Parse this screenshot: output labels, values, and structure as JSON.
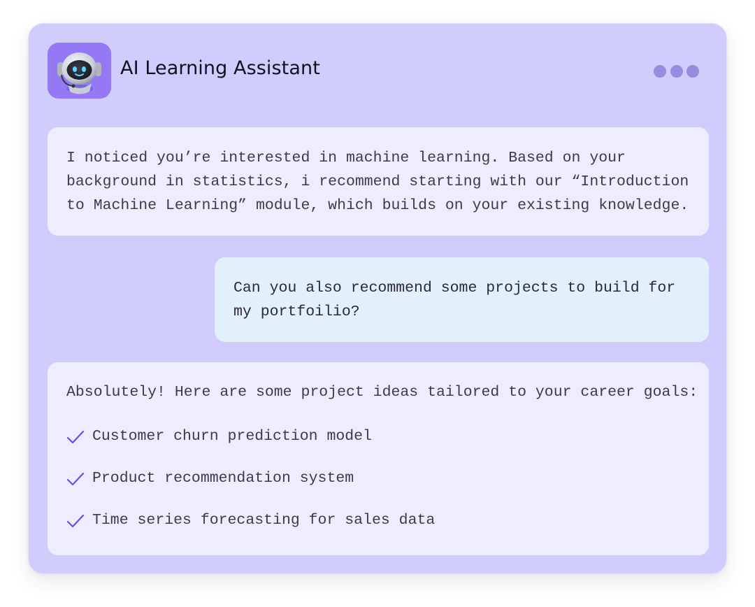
{
  "header": {
    "title": "AI Learning Assistant",
    "avatar_icon": "robot-icon",
    "menu_icon": "more-horizontal-icon"
  },
  "messages": [
    {
      "sender": "assistant",
      "text": "I noticed you’re interested in machine learning. Based on your background in statistics, i recommend starting with our “Introduction to Machine Learning” module, which builds on your existing knowledge."
    },
    {
      "sender": "user",
      "text": "Can you also recommend some projects to build for my portfoilio?"
    },
    {
      "sender": "assistant",
      "intro": "Absolutely! Here are some project ideas tailored to your career goals:",
      "projects": [
        "Customer churn prediction model",
        "Product recommendation system",
        "Time series forecasting for sales data"
      ],
      "item_icon": "check-icon"
    }
  ],
  "colors": {
    "card_background": "#d0ccfc",
    "assistant_bubble": "#eeedfd",
    "user_bubble": "#e1f0fa",
    "avatar_background": "#9478f4",
    "menu_dots": "#958ce0",
    "check_accent": "#6a4ee8"
  }
}
